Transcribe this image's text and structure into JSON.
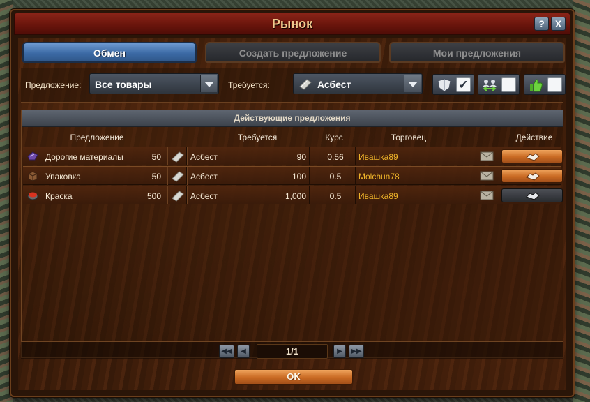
{
  "window": {
    "title": "Рынок",
    "help_label": "?",
    "close_label": "X"
  },
  "tabs": [
    {
      "label": "Обмен",
      "active": true
    },
    {
      "label": "Создать предложение",
      "active": false
    },
    {
      "label": "Мои предложения",
      "active": false
    }
  ],
  "filters": {
    "offer_label": "Предложение:",
    "offer_value": "Все товары",
    "need_label": "Требуется:",
    "need_value": "Асбест",
    "need_icon": "asbestos-icon",
    "toggles": [
      {
        "icon": "guild-shield-icon",
        "checked": true,
        "mark": "✓"
      },
      {
        "icon": "trade-partners-icon",
        "checked": false,
        "mark": ""
      },
      {
        "icon": "fair-trade-thumb-icon",
        "checked": false,
        "mark": ""
      }
    ]
  },
  "offers_panel": {
    "title": "Действующие предложения",
    "columns": {
      "offer": "Предложение",
      "need": "Требуется",
      "rate": "Курс",
      "trader": "Торговец",
      "action": "Действие"
    },
    "rows": [
      {
        "offer_icon": "precious-materials-icon",
        "offer_name": "Дорогие материалы",
        "offer_amount": "50",
        "need_icon": "asbestos-icon",
        "need_name": "Асбест",
        "need_amount": "90",
        "rate": "0.56",
        "trader": "Ивашка89",
        "action_state": "enabled"
      },
      {
        "offer_icon": "packaging-icon",
        "offer_name": "Упаковка",
        "offer_amount": "50",
        "need_icon": "asbestos-icon",
        "need_name": "Асбест",
        "need_amount": "100",
        "rate": "0.5",
        "trader": "Molchun78",
        "action_state": "enabled"
      },
      {
        "offer_icon": "paint-icon",
        "offer_name": "Краска",
        "offer_amount": "500",
        "need_icon": "asbestos-icon",
        "need_name": "Асбест",
        "need_amount": "1,000",
        "rate": "0.5",
        "trader": "Ивашка89",
        "action_state": "disabled"
      }
    ]
  },
  "pagination": {
    "current": "1/1"
  },
  "footer": {
    "ok_label": "OK"
  },
  "colors": {
    "trader_name": "#f0b52a",
    "active_tab": "#3c6aa5",
    "action_button": "#c96a23"
  }
}
